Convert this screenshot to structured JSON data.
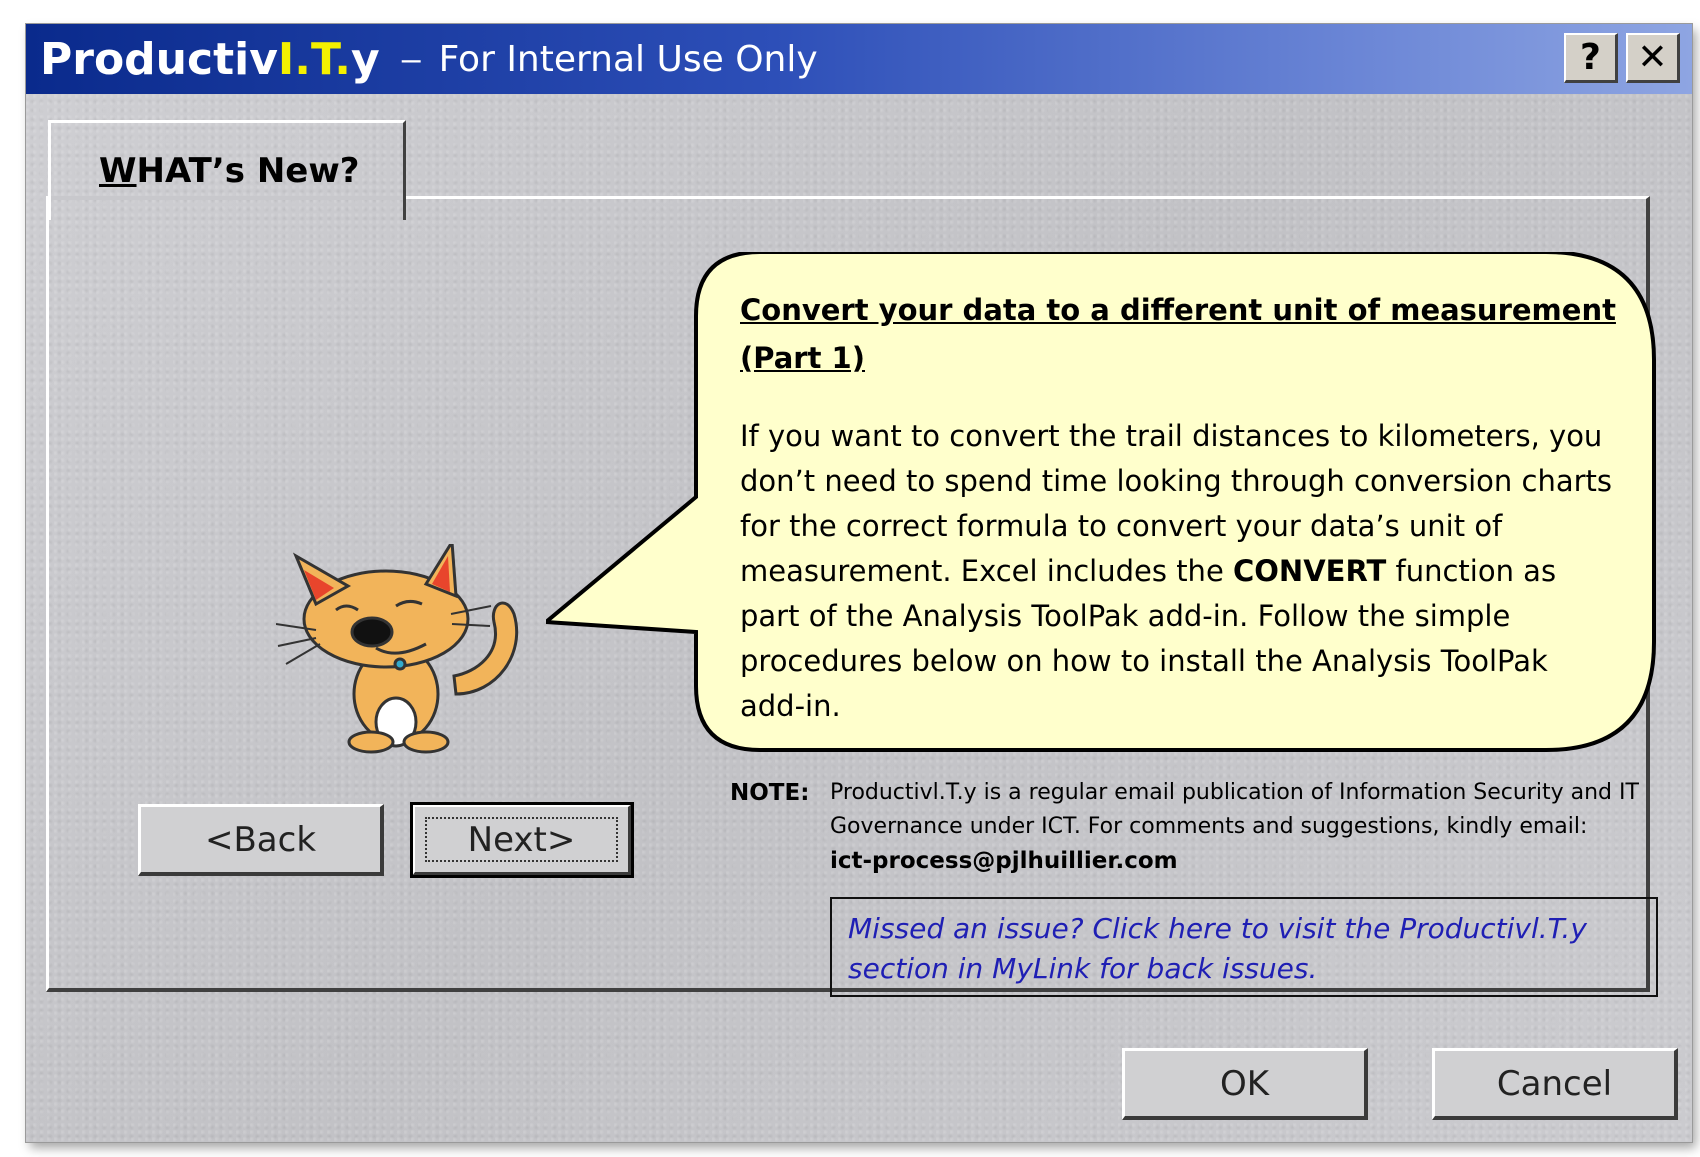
{
  "window": {
    "brand_prefix": "Productiv",
    "brand_highlight_1": "I.",
    "brand_highlight_2": "T.",
    "brand_suffix": "y",
    "separator": "–",
    "subtitle": "For Internal Use Only",
    "help_label": "?",
    "close_label": "✕"
  },
  "tab": {
    "label_first": "W",
    "label_rest": "HAT’s New?"
  },
  "bubble": {
    "heading": "Convert your data to a different unit of measurement (Part 1)",
    "body_1": "If you want to convert the trail distances to kilometers, you don’t need to spend time looking through conversion charts for the correct formula to convert your data’s unit of measurement. Excel includes the ",
    "body_bold": "CONVERT",
    "body_2": " function as part of the Analysis ToolPak add-in. Follow the simple procedures below on how to install the Analysis ToolPak add-in."
  },
  "note": {
    "label": "NOTE:",
    "text": "Productivl.T.y is a regular email publication of Information Security and IT Governance under ICT. For comments and suggestions,  kindly email:",
    "email": "ict-process@pjlhuillier.com"
  },
  "link": {
    "text": "Missed an issue? Click here to visit the Productivl.T.y section in MyLink for back issues."
  },
  "buttons": {
    "back": "<Back",
    "next": "Next>",
    "ok": "OK",
    "cancel": "Cancel"
  },
  "colors": {
    "titlebar_start": "#0a2a8c",
    "titlebar_end": "#8ea5e2",
    "brand_highlight": "#f4f000",
    "bubble_fill": "#ffffcc",
    "link_color": "#1f1fb4"
  },
  "icons": [
    "help-icon",
    "close-icon",
    "cat-mascot-icon"
  ]
}
